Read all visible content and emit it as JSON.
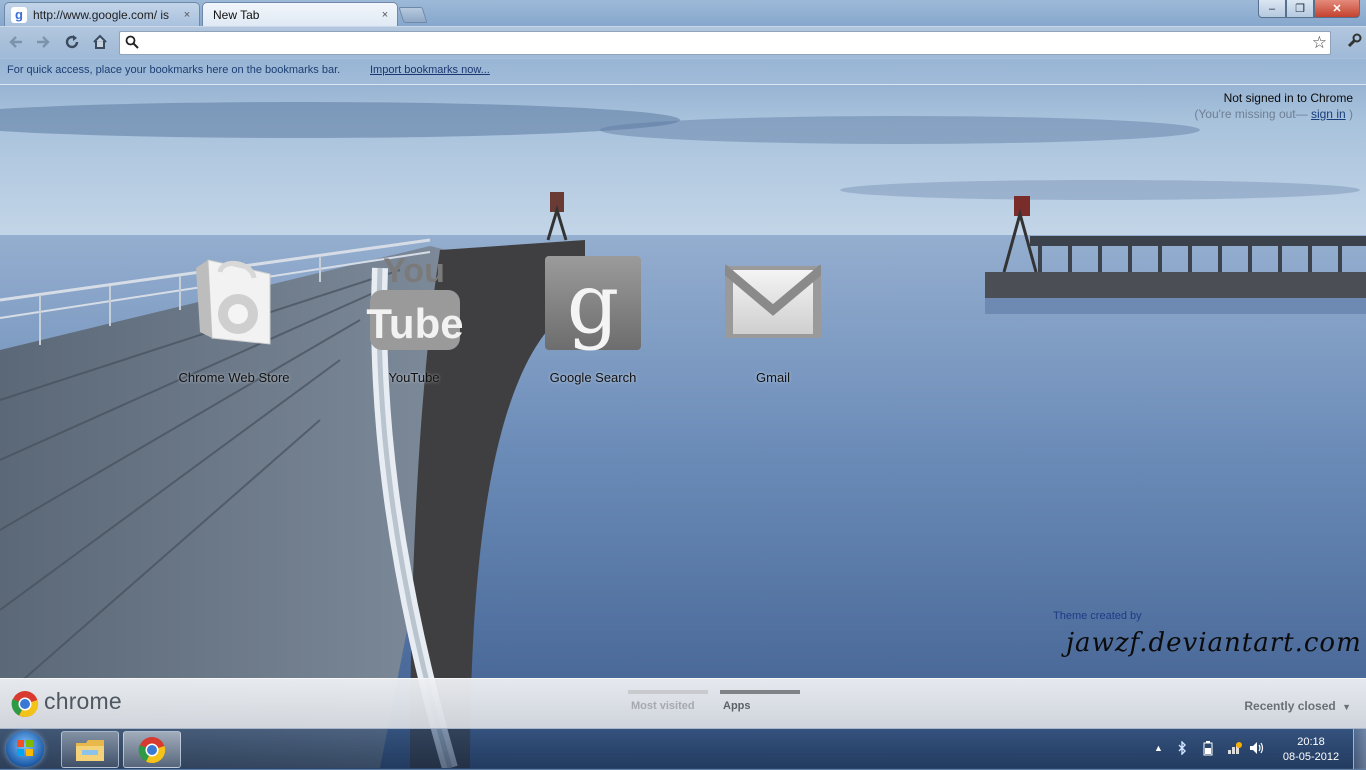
{
  "tabs": [
    {
      "title": "http://www.google.com/ is",
      "close": "×"
    },
    {
      "title": "New Tab",
      "close": "×"
    }
  ],
  "window_controls": {
    "minimize": "–",
    "maximize": "❐",
    "close": "✕"
  },
  "omnibox": {
    "value": "",
    "placeholder": ""
  },
  "bookmarks_bar": {
    "hint": "For quick access, place your bookmarks here on the bookmarks bar.",
    "import_link": "Import bookmarks now..."
  },
  "signin": {
    "line1": "Not signed in to Chrome",
    "line2": "(You're missing out—",
    "link": "sign in",
    "line2_end": ")"
  },
  "apps": [
    {
      "label": "Chrome Web Store"
    },
    {
      "label": "YouTube"
    },
    {
      "label": "Google Search"
    },
    {
      "label": "Gmail"
    }
  ],
  "theme_credit": {
    "label": "Theme created by",
    "signature": "jawzf.deviantart.com"
  },
  "footer": {
    "brand": "chrome",
    "tabs": [
      {
        "label": "Most visited"
      },
      {
        "label": "Apps"
      }
    ],
    "recently_closed": "Recently closed"
  },
  "taskbar": {
    "time": "20:18",
    "date": "08-05-2012"
  },
  "icons": {
    "back": "back-arrow-icon",
    "forward": "forward-arrow-icon",
    "reload": "reload-icon",
    "home": "home-icon",
    "search": "search-icon",
    "star": "star-icon",
    "wrench": "wrench-icon"
  },
  "colors": {
    "link": "#1b3770",
    "accent": "#4f5761"
  }
}
